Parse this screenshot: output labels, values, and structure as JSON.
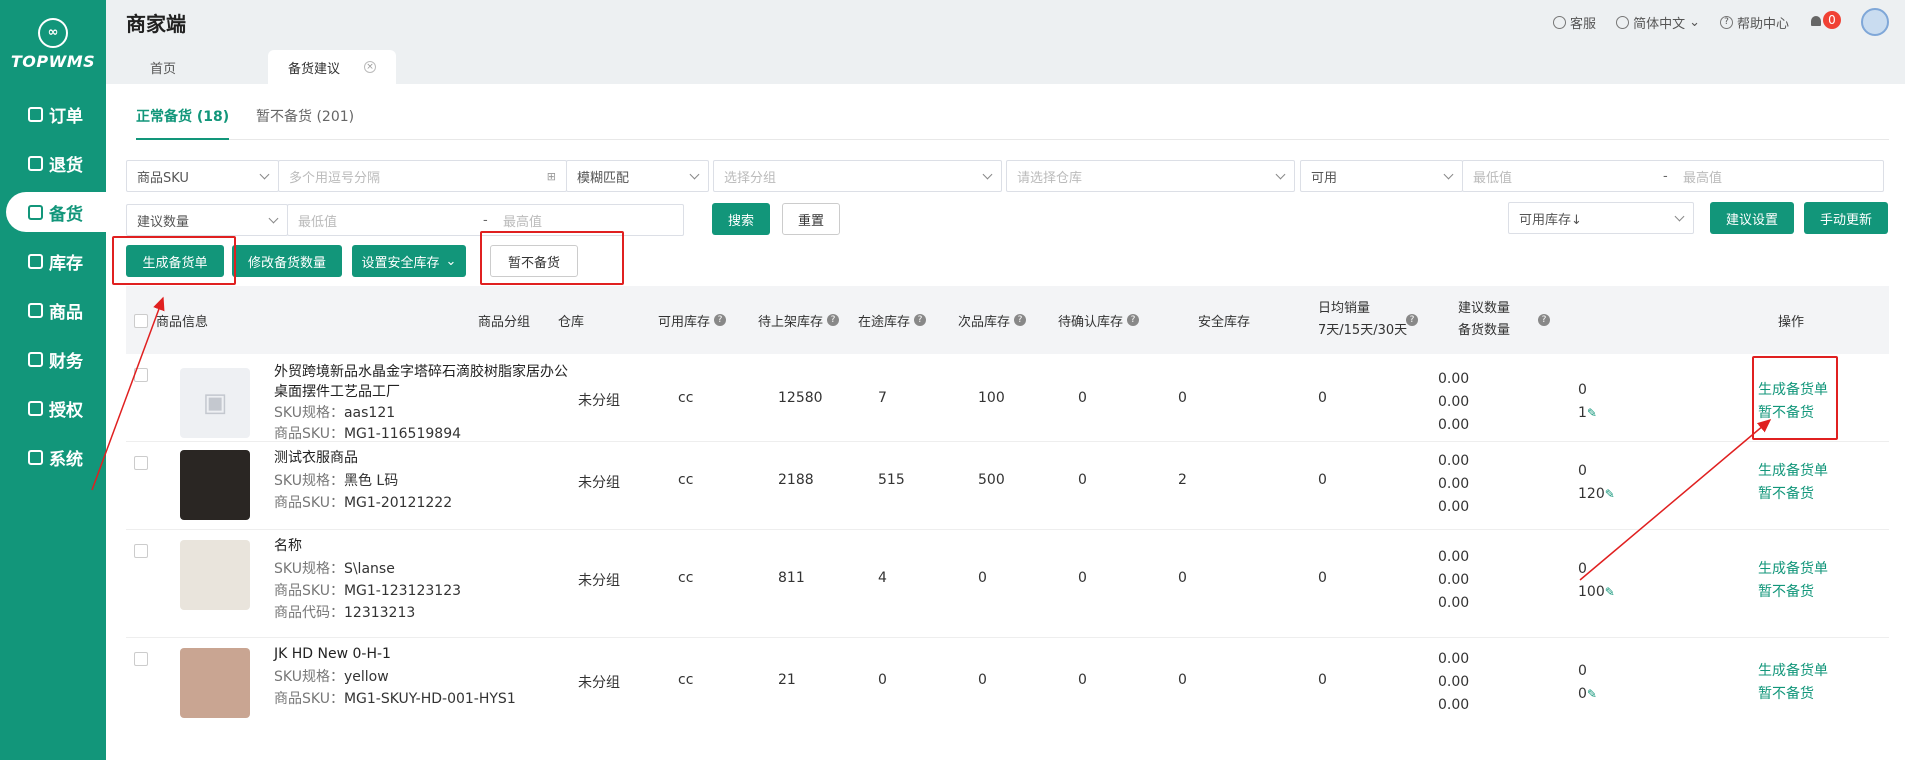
{
  "sidebar": {
    "logo": "TOPWMS",
    "items": [
      {
        "label": "订单"
      },
      {
        "label": "退货"
      },
      {
        "label": "备货"
      },
      {
        "label": "库存"
      },
      {
        "label": "商品"
      },
      {
        "label": "财务"
      },
      {
        "label": "授权"
      },
      {
        "label": "系统"
      }
    ]
  },
  "header": {
    "title": "商家端",
    "service": "客服",
    "language": "简体中文",
    "help": "帮助中心",
    "notifications": "0"
  },
  "tabs": [
    {
      "label": "首页"
    },
    {
      "label": "备货建议"
    }
  ],
  "subtabs": [
    {
      "label": "正常备货 (18)"
    },
    {
      "label": "暂不备货 (201)"
    }
  ],
  "filters": {
    "sku_type": "商品SKU",
    "sku_placeholder": "多个用逗号分隔",
    "match": "模糊匹配",
    "group_placeholder": "选择分组",
    "warehouse_placeholder": "请选择仓库",
    "stock_type": "可用",
    "min_placeholder": "最低值",
    "max_placeholder": "最高值",
    "qty_type": "建议数量",
    "dash": "-"
  },
  "buttons": {
    "search": "搜索",
    "reset": "重置",
    "generate": "生成备货单",
    "modify": "修改备货数量",
    "safety": "设置安全库存",
    "pause": "暂不备货",
    "sort": "可用库存↓",
    "settings": "建议设置",
    "manual": "手动更新"
  },
  "table": {
    "headers": {
      "info": "商品信息",
      "group": "商品分组",
      "warehouse": "仓库",
      "available": "可用库存",
      "pending_shelf": "待上架库存",
      "in_transit": "在途库存",
      "defective": "次品库存",
      "pending_confirm": "待确认库存",
      "safety": "安全库存",
      "sales_line1": "日均销量",
      "sales_line2": "7天/15天/30天",
      "sugg_line1": "建议数量",
      "sugg_line2": "备货数量",
      "ops": "操作"
    },
    "labels": {
      "spec": "SKU规格：",
      "sku": "商品SKU：",
      "code": "商品代码："
    },
    "rows": [
      {
        "name": "外贸跨境新品水晶金字塔碎石滴胶树脂家居办公桌面摆件工艺品工厂",
        "spec": "aas121",
        "sku": "MG1-116519894",
        "code": "",
        "group": "未分组",
        "warehouse": "cc",
        "available": "12580",
        "pending_shelf": "7",
        "in_transit": "100",
        "defective": "0",
        "pending_confirm": "0",
        "safety": "0",
        "sales": [
          "0.00",
          "0.00",
          "0.00"
        ],
        "suggested": "0",
        "stock_qty": "1",
        "op_generate": "生成备货单",
        "op_pause": "暂不备货"
      },
      {
        "name": "测试衣服商品",
        "spec": "黑色 L码",
        "sku": "MG1-20121222",
        "code": "",
        "group": "未分组",
        "warehouse": "cc",
        "available": "2188",
        "pending_shelf": "515",
        "in_transit": "500",
        "defective": "0",
        "pending_confirm": "2",
        "safety": "0",
        "sales": [
          "0.00",
          "0.00",
          "0.00"
        ],
        "suggested": "0",
        "stock_qty": "120",
        "op_generate": "生成备货单",
        "op_pause": "暂不备货"
      },
      {
        "name": "名称",
        "spec": "S\\lanse",
        "sku": "MG1-123123123",
        "code": "12313213",
        "group": "未分组",
        "warehouse": "cc",
        "available": "811",
        "pending_shelf": "4",
        "in_transit": "0",
        "defective": "0",
        "pending_confirm": "0",
        "safety": "0",
        "sales": [
          "0.00",
          "0.00",
          "0.00"
        ],
        "suggested": "0",
        "stock_qty": "100",
        "op_generate": "生成备货单",
        "op_pause": "暂不备货"
      },
      {
        "name": "JK HD New 0-H-1",
        "spec": "yellow",
        "sku": "MG1-SKUY-HD-001-HYS1",
        "code": "",
        "group": "未分组",
        "warehouse": "cc",
        "available": "21",
        "pending_shelf": "0",
        "in_transit": "0",
        "defective": "0",
        "pending_confirm": "0",
        "safety": "0",
        "sales": [
          "0.00",
          "0.00",
          "0.00"
        ],
        "suggested": "0",
        "stock_qty": "0",
        "op_generate": "生成备货单",
        "op_pause": "暂不备货"
      }
    ]
  },
  "colors": {
    "brand": "#12967a",
    "annotation": "#e02020"
  }
}
